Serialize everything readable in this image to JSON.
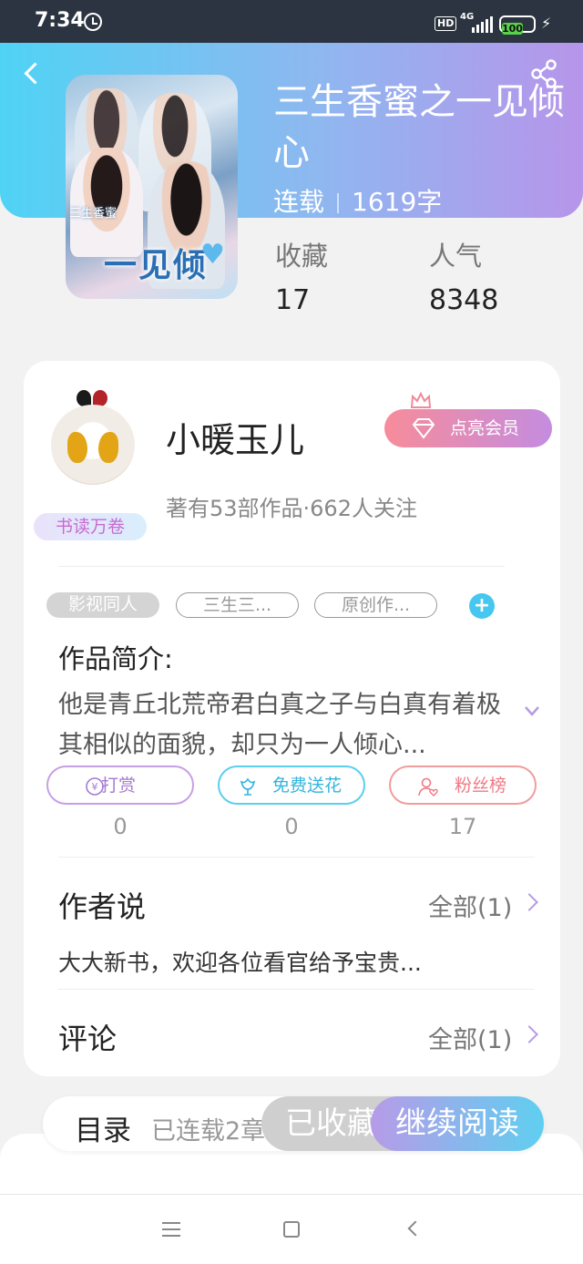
{
  "status_bar": {
    "time": "7:34",
    "hd": "HD",
    "network": "4G",
    "battery": "100"
  },
  "book": {
    "title": "三生香蜜之一见倾心",
    "status": "连载",
    "word_count": "1619字",
    "cover_text_small": "三生香蜜",
    "cover_text_big": "一见倾",
    "stats": {
      "favorites_label": "收藏",
      "favorites": "17",
      "popularity_label": "人气",
      "popularity": "8348"
    }
  },
  "author": {
    "name": "小暖玉儿",
    "badge": "书读万卷",
    "vip_button": "点亮会员",
    "works_info": "著有53部作品·662人关注"
  },
  "tags": [
    "影视同人",
    "三生三...",
    "原创作..."
  ],
  "intro": {
    "heading": "作品简介:",
    "text": "他是青丘北荒帝君白真之子与白真有着极其相似的面貌，却只为一人倾心..."
  },
  "actions": {
    "reward": {
      "label": "打赏",
      "count": "0"
    },
    "flower": {
      "label": "免费送花",
      "count": "0"
    },
    "fans": {
      "label": "粉丝榜",
      "count": "17"
    }
  },
  "author_says": {
    "heading": "作者说",
    "all_label": "全部(1)",
    "text": "大大新书，欢迎各位看官给予宝贵..."
  },
  "comments": {
    "heading": "评论",
    "all_label": "全部(1)"
  },
  "bottom_bar": {
    "toc_label": "目录",
    "toc_count": "已连载2章",
    "favorited_label": "已收藏",
    "continue_label": "继续阅读"
  },
  "colors": {
    "accent_blue": "#4fd3f4",
    "accent_purple": "#b795ea",
    "vip_pink": "#f78c9a"
  }
}
